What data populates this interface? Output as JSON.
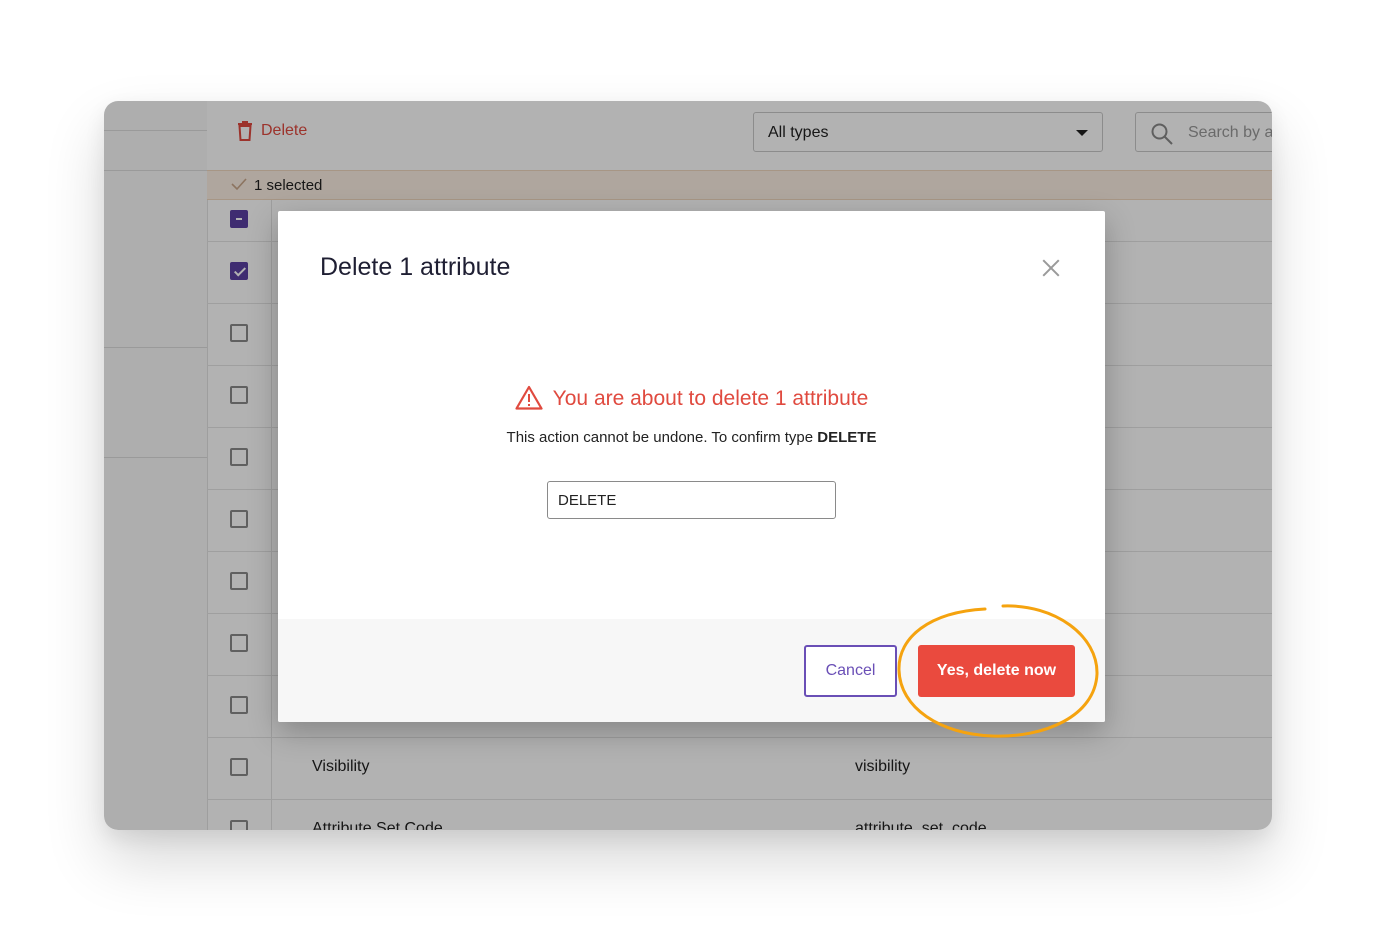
{
  "toolbar": {
    "delete_label": "Delete",
    "type_filter_value": "All types",
    "search_placeholder": "Search by a"
  },
  "selection": {
    "text": "1 selected"
  },
  "table": {
    "rows": [
      {
        "name": "Visibility",
        "code": "visibility",
        "checked": false
      },
      {
        "name": "Attribute Set Code",
        "code": "attribute_set_code",
        "checked": false
      }
    ]
  },
  "modal": {
    "title": "Delete 1 attribute",
    "warning": "You are about to delete 1 attribute",
    "info_prefix": "This action cannot be undone. To confirm type",
    "info_keyword": "DELETE",
    "input_value": "DELETE",
    "cancel_label": "Cancel",
    "confirm_label": "Yes, delete now"
  },
  "colors": {
    "danger": "#ea4a3e",
    "primary": "#6a4fb6",
    "annotation": "#f5a30f"
  }
}
